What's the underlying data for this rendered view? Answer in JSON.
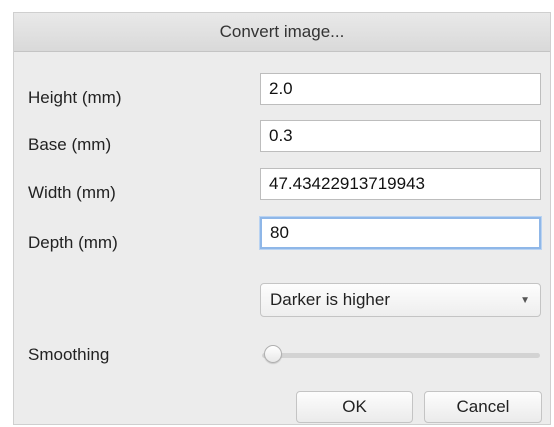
{
  "dialog": {
    "title": "Convert image..."
  },
  "fields": {
    "height": {
      "label": "Height (mm)",
      "value": "2.0"
    },
    "base": {
      "label": "Base (mm)",
      "value": "0.3"
    },
    "width": {
      "label": "Width (mm)",
      "value": "47.43422913719943"
    },
    "depth": {
      "label": "Depth (mm)",
      "value": "80"
    }
  },
  "mode_select": {
    "selected": "Darker is higher",
    "icon": "chevron-down-icon"
  },
  "smoothing": {
    "label": "Smoothing",
    "level": 0
  },
  "buttons": {
    "ok": "OK",
    "cancel": "Cancel"
  }
}
